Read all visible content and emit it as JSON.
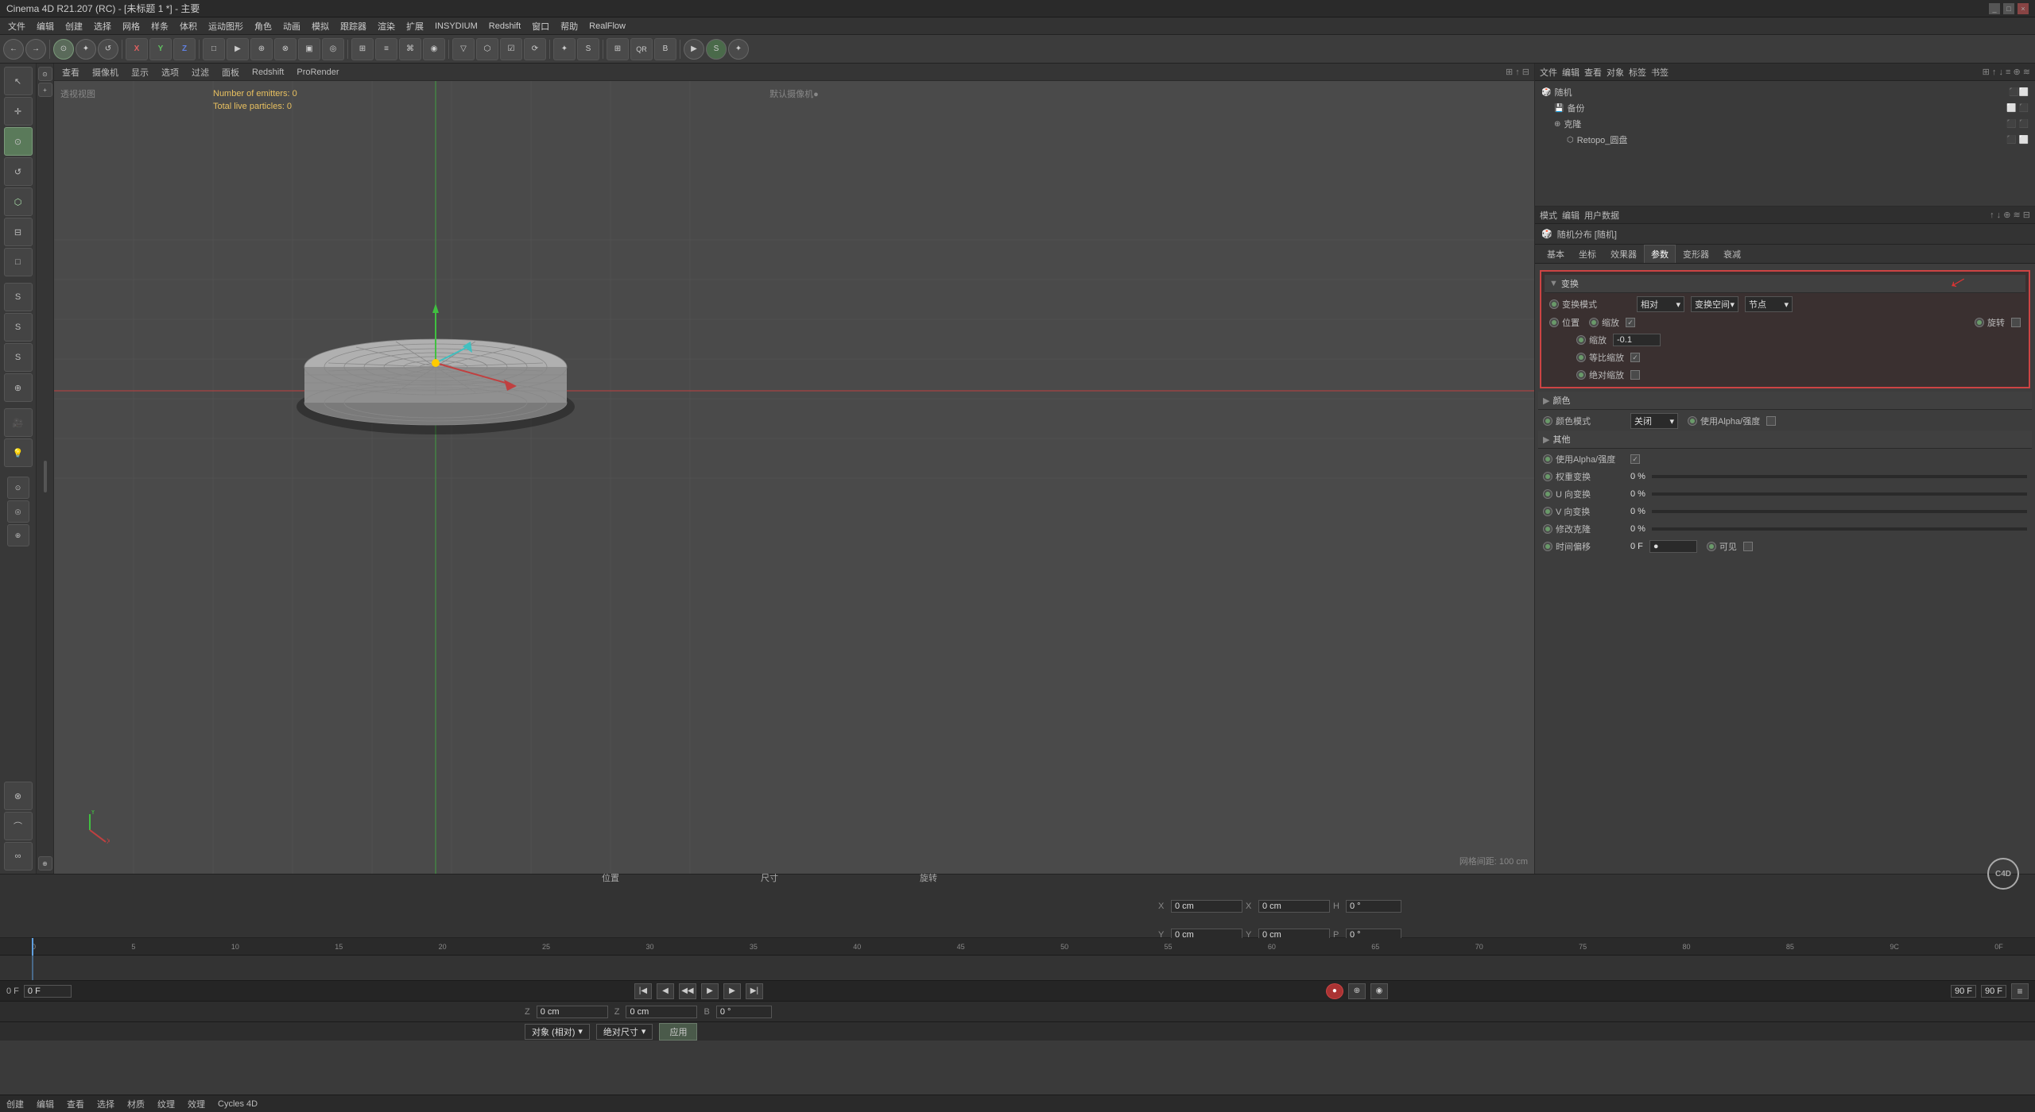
{
  "titlebar": {
    "title": "Cinema 4D R21.207 (RC) - [未标题 1 *] - 主要",
    "controls": [
      "_",
      "□",
      "×"
    ]
  },
  "menubar": {
    "items": [
      "文件",
      "编辑",
      "创建",
      "选择",
      "网格",
      "样条",
      "体积",
      "运动图形",
      "角色",
      "动画",
      "模拟",
      "跟踪器",
      "渲染",
      "扩展",
      "INSYDIUM",
      "Redshift",
      "窗口",
      "帮助",
      "RealFlow"
    ]
  },
  "toolbar": {
    "items": [
      "←",
      "→",
      "⊙",
      "✦",
      "↺",
      "X",
      "Y",
      "Z",
      "□",
      "▶",
      "⊕",
      "⊗",
      "▣",
      "◎",
      "⊞",
      "≡",
      "⌘",
      "◉",
      "▽",
      "⬡",
      "☑",
      "⟳",
      "✦",
      "S",
      "▲",
      "⊟",
      "⊕",
      "↕",
      "⊞",
      "≋",
      "⊕",
      "⊞",
      "▷",
      "⌂",
      "QR",
      "B",
      "▶",
      "S",
      "✦"
    ]
  },
  "viewport": {
    "toolbar_items": [
      "查看",
      "摄像机",
      "显示",
      "选项",
      "过滤",
      "面板",
      "Redshift",
      "ProRender"
    ],
    "label": "透视视图",
    "camera": "默认摄像机●",
    "particle_info": {
      "line1": "Number of emitters: 0",
      "line2": "Total live particles: 0"
    },
    "grid_size": "网格间距: 100 cm",
    "snap_info": "0 F"
  },
  "scene_manager": {
    "toolbar": {
      "items": [
        "文件",
        "编辑",
        "查看",
        "对象",
        "标签",
        "书签"
      ]
    },
    "tree": [
      {
        "name": "随机",
        "icon": "🎲",
        "indent": 0,
        "has_dots": true
      },
      {
        "name": "备份",
        "icon": "💾",
        "indent": 1,
        "has_dots": true
      },
      {
        "name": "克隆",
        "icon": "⊕",
        "indent": 1,
        "has_dots": true
      },
      {
        "name": "Retopo_圆盘",
        "icon": "⬡",
        "indent": 2,
        "has_dots": true
      }
    ]
  },
  "properties_panel": {
    "toolbar": {
      "items": [
        "模式",
        "编辑",
        "用户数据"
      ]
    },
    "breadcrumb": "随机分布 [随机]",
    "tabs": [
      "基本",
      "坐标",
      "效果器",
      "参数",
      "变形器",
      "衰减"
    ],
    "active_tab": "参数",
    "sections": {
      "transform": {
        "title": "变换",
        "highlighted": true,
        "rows": [
          {
            "label": "变换模式",
            "type": "dropdown_row",
            "values": [
              "相对",
              "变换空间",
              "节点"
            ]
          },
          {
            "label": "",
            "type": "radio_row",
            "options": [
              "位置",
              "缩放",
              "旋转"
            ],
            "checkbox_after_scale": true
          },
          {
            "label": "",
            "type": "scale_value",
            "value": "-0.1"
          },
          {
            "label": "",
            "type": "checkbox_row",
            "options": [
              "等比缩放",
              "绝对缩放"
            ]
          }
        ]
      },
      "color": {
        "title": "颜色",
        "rows": [
          {
            "label": "颜色模式",
            "values": [
              "关闭",
              "使用Alpha/强度"
            ]
          }
        ]
      },
      "other": {
        "title": "其他",
        "rows": [
          {
            "label": "使用Alpha/强度",
            "type": "checkbox",
            "checked": true
          },
          {
            "label": "权重变换",
            "value": "0 %",
            "bar": true
          },
          {
            "label": "U 向变换",
            "value": "0 %",
            "bar": true
          },
          {
            "label": "V 向变换",
            "value": "0 %",
            "bar": true
          },
          {
            "label": "修改克隆",
            "value": "0 %",
            "bar": true
          },
          {
            "label": "时间偏移",
            "value": "0 F",
            "has_dropdown": true,
            "has_checkbox": true,
            "checkbox_label": "可见"
          }
        ]
      }
    }
  },
  "timeline": {
    "current_frame": "0 F",
    "start_frame": "0 F",
    "end_frame": "90 F",
    "fps_frame": "90 F",
    "ruler_marks": [
      "0",
      "5",
      "10",
      "15",
      "20",
      "25",
      "30",
      "35",
      "40",
      "45",
      "50",
      "55",
      "60",
      "65",
      "70",
      "75",
      "80",
      "85",
      "9C",
      "0F"
    ]
  },
  "statusbar": {
    "items": [
      "创建",
      "编辑",
      "查看",
      "选择",
      "材质",
      "纹理",
      "效理",
      "Cycles 4D"
    ]
  },
  "coord_section": {
    "position_label": "位置",
    "size_label": "尺寸",
    "rotation_label": "旋转",
    "fields": {
      "pos_x": "0 cm",
      "pos_y": "0 cm",
      "pos_z": "0 cm",
      "size_x": "0 cm",
      "size_y": "0 cm",
      "size_z": "0 cm",
      "rot_h": "0 °",
      "rot_p": "0 °",
      "rot_b": "0 °"
    },
    "dropdown1": "对象 (相对)",
    "dropdown2": "绝对尺寸",
    "apply_btn": "应用"
  },
  "icons": {
    "expand": "▶",
    "collapse": "▼",
    "check": "✓",
    "radio_dot": "●",
    "arrow_right": "→"
  }
}
